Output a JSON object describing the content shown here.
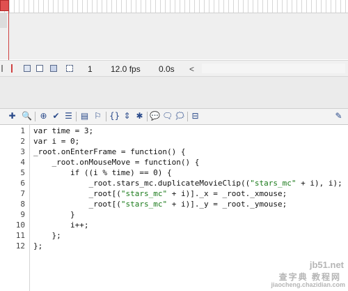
{
  "timeline": {
    "frame_number": "1",
    "frame_rate": "12.0 fps",
    "elapsed_time": "0.0s",
    "scroll_left_glyph": "<"
  },
  "actions_toolbar": {
    "buttons": [
      {
        "name": "add-statement-icon",
        "glyph": "✚"
      },
      {
        "name": "find-icon",
        "glyph": "🔍"
      },
      {
        "name": "target-path-icon",
        "glyph": "⊕"
      },
      {
        "name": "check-syntax-icon",
        "glyph": "✔"
      },
      {
        "name": "auto-format-icon",
        "glyph": "☰"
      },
      {
        "name": "code-hint-icon",
        "glyph": "▤"
      },
      {
        "name": "debug-options-icon",
        "glyph": "⚐"
      },
      {
        "name": "collapse-between-braces-icon",
        "glyph": "{}"
      },
      {
        "name": "collapse-selection-icon",
        "glyph": "⇕"
      },
      {
        "name": "expand-all-icon",
        "glyph": "✱"
      },
      {
        "name": "apply-block-comment-icon",
        "glyph": "💬"
      },
      {
        "name": "apply-line-comment-icon",
        "glyph": "🗨"
      },
      {
        "name": "remove-comment-icon",
        "glyph": "🗯"
      },
      {
        "name": "show-hide-toolbox-icon",
        "glyph": "⊟"
      },
      {
        "name": "script-assist-icon",
        "glyph": "✎"
      }
    ]
  },
  "code": {
    "line_numbers": [
      "1",
      "2",
      "3",
      "4",
      "5",
      "6",
      "7",
      "8",
      "9",
      "10",
      "11",
      "12"
    ],
    "lines": [
      "var time = 3;",
      "var i = 0;",
      "_root.onEnterFrame = function() {",
      "    _root.onMouseMove = function() {",
      "        if ((i % time) == 0) {",
      "            _root.stars_mc.duplicateMovieClip((\"stars_mc\" + i), i);",
      "            _root[(\"stars_mc\" + i)]._x = _root._xmouse;",
      "            _root[(\"stars_mc\" + i)]._y = _root._ymouse;",
      "        }",
      "        i++;",
      "    };",
      "};"
    ]
  },
  "watermark": {
    "site": "jb51.net",
    "chinese": "查字典 教程网",
    "domain": "jiaocheng.chazidian.com"
  }
}
